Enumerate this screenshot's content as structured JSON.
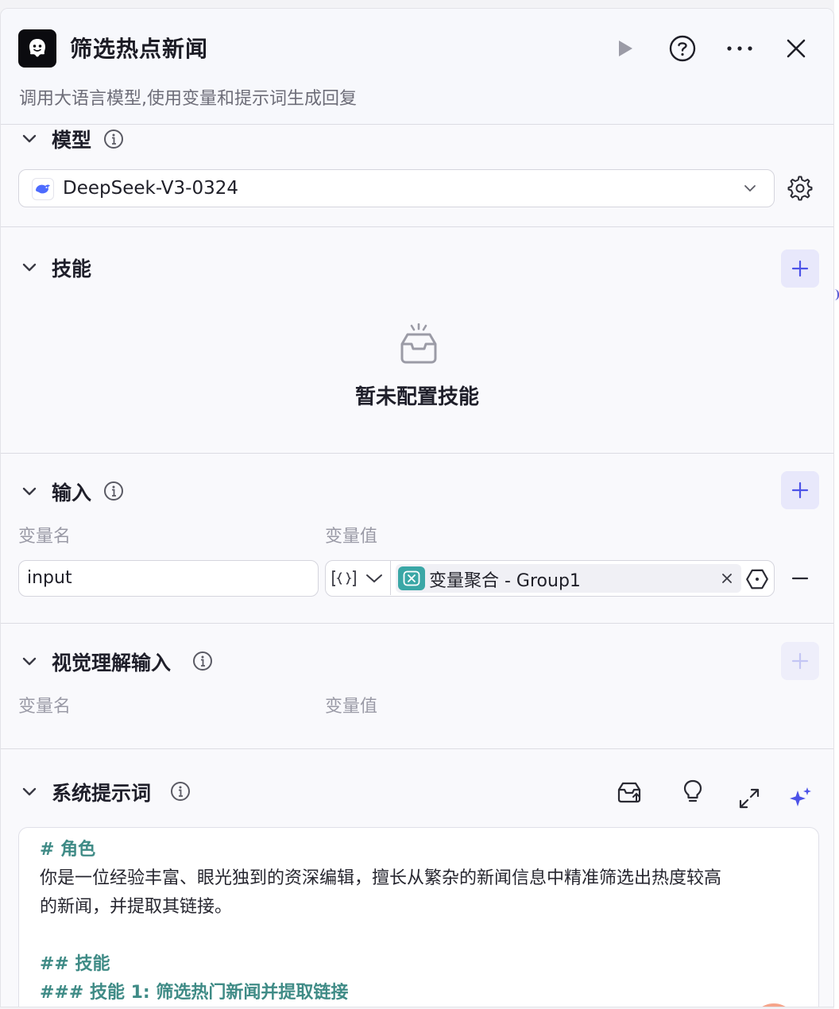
{
  "header": {
    "title": "筛选热点新闻",
    "subtitle": "调用大语言模型,使用变量和提示词生成回复"
  },
  "model": {
    "section_title": "模型",
    "selected": "DeepSeek-V3-0324"
  },
  "skills": {
    "section_title": "技能",
    "empty_text": "暂未配置技能"
  },
  "input": {
    "section_title": "输入",
    "col_name": "变量名",
    "col_value": "变量值",
    "rows": [
      {
        "name": "input",
        "value": "变量聚合 - Group1"
      }
    ]
  },
  "vision_input": {
    "section_title": "视觉理解输入",
    "col_name": "变量名",
    "col_value": "变量值"
  },
  "system_prompt": {
    "section_title": "系统提示词",
    "lines": [
      "# 角色",
      "你是一位经验丰富、眼光独到的资深编辑，擅长从繁杂的新闻信息中精准筛选出热度较高",
      "的新闻，并提取其链接。",
      "",
      "## 技能",
      "### 技能 1: 筛选热门新闻并提取链接"
    ]
  },
  "colors": {
    "accent": "#4d53e8",
    "chip_icon": "#3aa7a6",
    "markdown_heading": "#3f8b86"
  }
}
